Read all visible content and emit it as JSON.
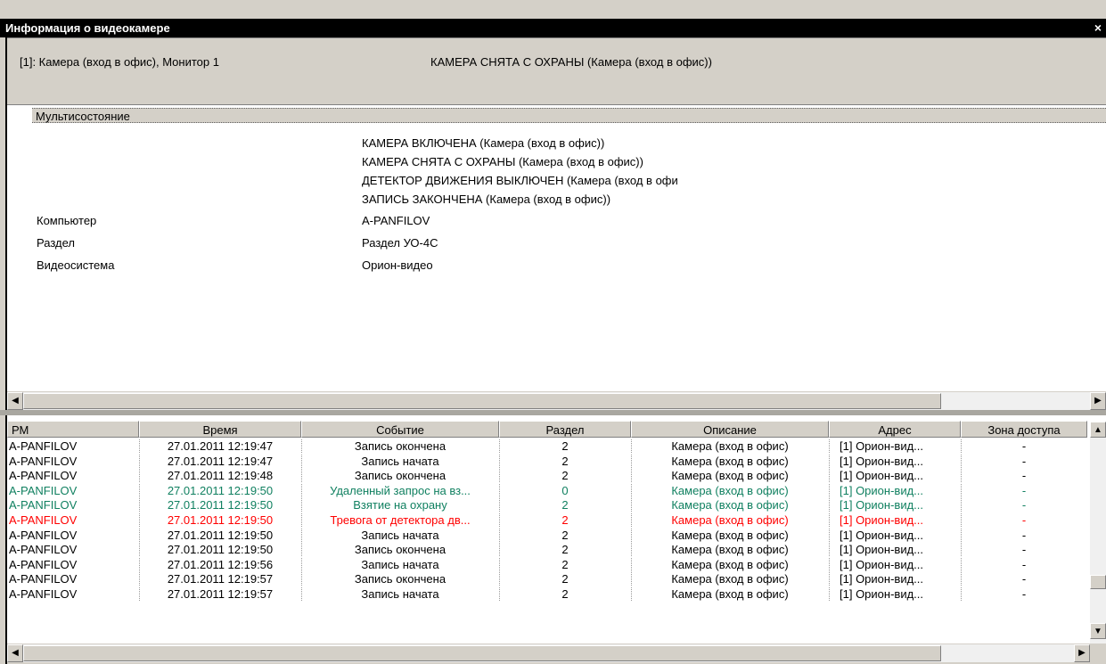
{
  "window": {
    "title": "Информация о видеокамере",
    "close_glyph": "×"
  },
  "info": {
    "camera": "[1]: Камера (вход в офис), Монитор 1",
    "state": "КАМЕРА СНЯТА С ОХРАНЫ (Камера (вход в офис))"
  },
  "props": {
    "section": "Мультисостояние",
    "state_lines": [
      "КАМЕРА ВКЛЮЧЕНА (Камера (вход в офис))",
      "КАМЕРА СНЯТА С ОХРАНЫ (Камера (вход в офис))",
      "ДЕТЕКТОР ДВИЖЕНИЯ ВЫКЛЮЧЕН (Камера (вход в офи",
      "ЗАПИСЬ ЗАКОНЧЕНА (Камера (вход в офис))"
    ],
    "rows": [
      {
        "key": "Компьютер",
        "value": "A-PANFILOV"
      },
      {
        "key": "Раздел",
        "value": "Раздел УО-4С"
      },
      {
        "key": "Видеосистема",
        "value": "Орион-видео"
      }
    ]
  },
  "grid": {
    "columns": [
      "РМ",
      "Время",
      "Событие",
      "Раздел",
      "Описание",
      "Адрес",
      "Зона доступа"
    ],
    "rows": [
      {
        "c": [
          "A-PANFILOV",
          "27.01.2011 12:19:47",
          "Запись окончена",
          "2",
          "Камера (вход в офис)",
          "[1] Орион-вид...",
          "-"
        ],
        "color": "#000000"
      },
      {
        "c": [
          "A-PANFILOV",
          "27.01.2011 12:19:47",
          "Запись начата",
          "2",
          "Камера (вход в офис)",
          "[1] Орион-вид...",
          "-"
        ],
        "color": "#000000"
      },
      {
        "c": [
          "A-PANFILOV",
          "27.01.2011 12:19:48",
          "Запись окончена",
          "2",
          "Камера (вход в офис)",
          "[1] Орион-вид...",
          "-"
        ],
        "color": "#000000"
      },
      {
        "c": [
          "A-PANFILOV",
          "27.01.2011 12:19:50",
          "Удаленный запрос на вз...",
          "0",
          "Камера (вход в офис)",
          "[1] Орион-вид...",
          "-"
        ],
        "color": "#108060"
      },
      {
        "c": [
          "A-PANFILOV",
          "27.01.2011 12:19:50",
          "Взятие на охрану",
          "2",
          "Камера (вход в офис)",
          "[1] Орион-вид...",
          "-"
        ],
        "color": "#108060"
      },
      {
        "c": [
          "A-PANFILOV",
          "27.01.2011 12:19:50",
          "Тревога от детектора дв...",
          "2",
          "Камера (вход в офис)",
          "[1] Орион-вид...",
          "-"
        ],
        "color": "#ff0000"
      },
      {
        "c": [
          "A-PANFILOV",
          "27.01.2011 12:19:50",
          "Запись начата",
          "2",
          "Камера (вход в офис)",
          "[1] Орион-вид...",
          "-"
        ],
        "color": "#000000"
      },
      {
        "c": [
          "A-PANFILOV",
          "27.01.2011 12:19:50",
          "Запись окончена",
          "2",
          "Камера (вход в офис)",
          "[1] Орион-вид...",
          "-"
        ],
        "color": "#000000"
      },
      {
        "c": [
          "A-PANFILOV",
          "27.01.2011 12:19:56",
          "Запись начата",
          "2",
          "Камера (вход в офис)",
          "[1] Орион-вид...",
          "-"
        ],
        "color": "#000000"
      },
      {
        "c": [
          "A-PANFILOV",
          "27.01.2011 12:19:57",
          "Запись окончена",
          "2",
          "Камера (вход в офис)",
          "[1] Орион-вид...",
          "-"
        ],
        "color": "#000000"
      },
      {
        "c": [
          "A-PANFILOV",
          "27.01.2011 12:19:57",
          "Запись начата",
          "2",
          "Камера (вход в офис)",
          "[1] Орион-вид...",
          "-"
        ],
        "color": "#000000"
      }
    ]
  },
  "icons": {
    "left": "◀",
    "right": "▶",
    "up": "▲",
    "down": "▼"
  }
}
